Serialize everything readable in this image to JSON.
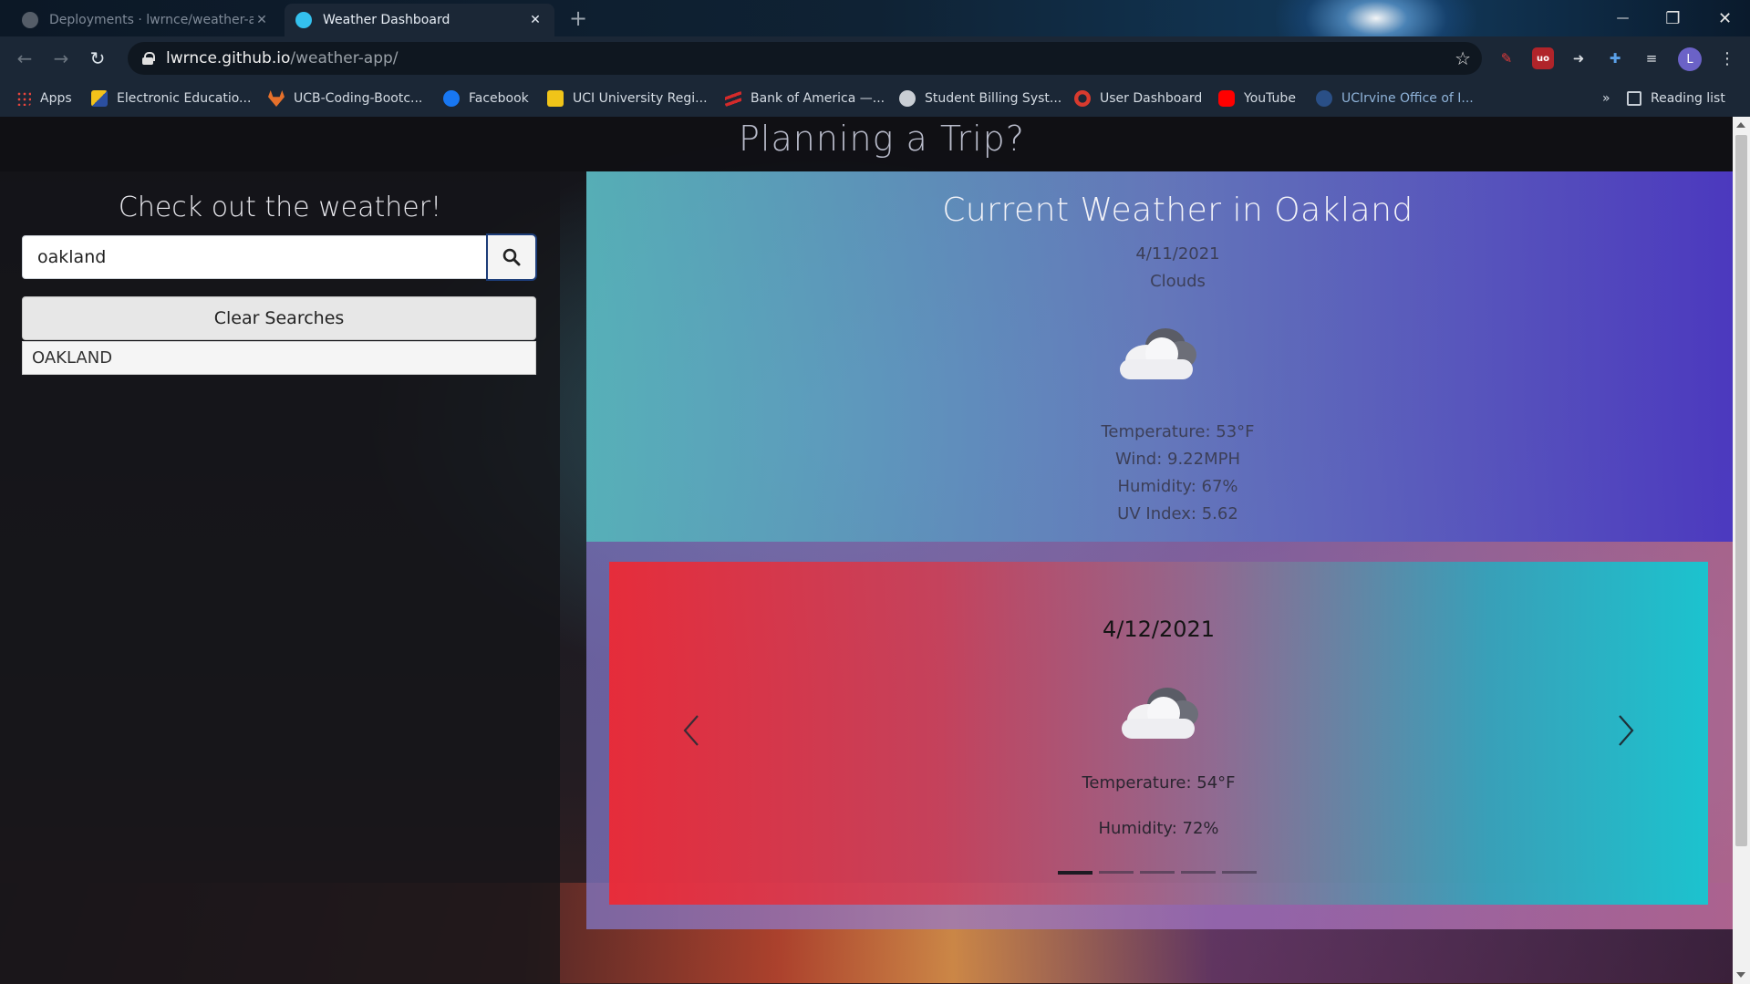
{
  "browser": {
    "tabs": [
      {
        "title": "Deployments · lwrnce/weather-a",
        "active": false,
        "close": "✕"
      },
      {
        "title": "Weather Dashboard",
        "active": true,
        "close": "✕"
      }
    ],
    "new_tab": "+",
    "window_controls": {
      "minimize": "—",
      "restore": "❐",
      "close": "✕"
    },
    "url_host": "lwrnce.github.io",
    "url_path": "/weather-app/",
    "star": "☆",
    "avatar_letter": "L",
    "bookmarks": [
      {
        "label": "Apps",
        "icon": "apps-grid-icon"
      },
      {
        "label": "Electronic Educatio...",
        "icon": "education-icon"
      },
      {
        "label": "UCB-Coding-Bootc...",
        "icon": "gitlab-icon"
      },
      {
        "label": "Facebook",
        "icon": "facebook-icon"
      },
      {
        "label": "UCI University Regi...",
        "icon": "reg-icon"
      },
      {
        "label": "Bank of America —...",
        "icon": "bank-icon"
      },
      {
        "label": "Student Billing Syst...",
        "icon": "globe-icon"
      },
      {
        "label": "User Dashboard",
        "icon": "dashboard-icon"
      },
      {
        "label": "YouTube",
        "icon": "youtube-icon"
      },
      {
        "label": "UCIrvine Office of I...",
        "icon": "uci-icon"
      }
    ],
    "bookmarks_overflow": "»",
    "reading_list": "Reading list"
  },
  "page": {
    "title": "Planning a Trip?",
    "search": {
      "heading": "Check out the weather!",
      "input_value": "oakland",
      "clear_label": "Clear Searches",
      "history": [
        "OAKLAND"
      ]
    },
    "current": {
      "title": "Current Weather in Oakland",
      "date": "4/11/2021",
      "condition": "Clouds",
      "icon": "clouds-icon",
      "temperature": "Temperature: 53°F",
      "wind": "Wind: 9.22MPH",
      "humidity": "Humidity: 67%",
      "uv": "UV Index: 5.62"
    },
    "forecast": {
      "date": "4/12/2021",
      "icon": "clouds-icon",
      "temperature": "Temperature: 54°F",
      "humidity": "Humidity: 72%",
      "slides": 5,
      "active_slide": 0
    }
  },
  "colors": {
    "current_panel_start": "#50c8be",
    "current_panel_end": "#3c32c8",
    "forecast_start": "#f02832",
    "forecast_end": "#14c8d2",
    "search_button_border": "#1c3c78"
  }
}
